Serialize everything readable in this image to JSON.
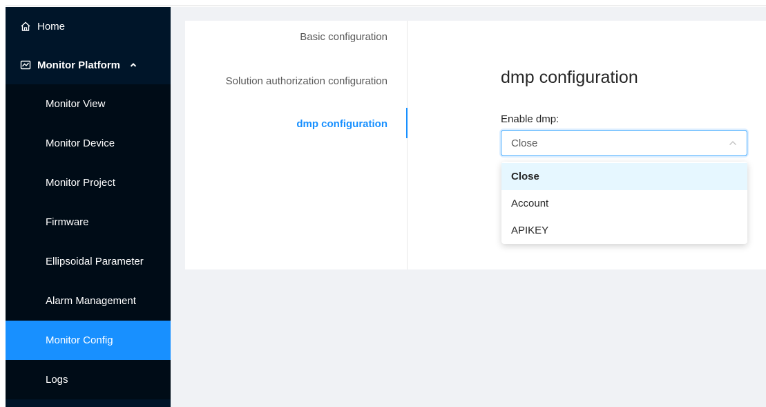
{
  "sidebar": {
    "home_label": "Home",
    "platform_label": "Monitor Platform",
    "items": [
      {
        "label": "Monitor View"
      },
      {
        "label": "Monitor Device"
      },
      {
        "label": "Monitor Project"
      },
      {
        "label": "Firmware"
      },
      {
        "label": "Ellipsoidal Parameter"
      },
      {
        "label": "Alarm Management"
      },
      {
        "label": "Monitor Config",
        "active": true
      },
      {
        "label": "Logs"
      }
    ]
  },
  "tabs": [
    {
      "label": "Basic configuration"
    },
    {
      "label": "Solution authorization configuration"
    },
    {
      "label": "dmp configuration",
      "active": true
    }
  ],
  "panel": {
    "title": "dmp configuration",
    "field_label": "Enable dmp:",
    "select_value": "Close",
    "options": [
      {
        "label": "Close",
        "selected": true
      },
      {
        "label": "Account"
      },
      {
        "label": "APIKEY"
      }
    ]
  },
  "colors": {
    "sidebar_bg": "#001529",
    "submenu_bg": "#000c17",
    "accent": "#1890ff",
    "main_bg": "#f0f2f5"
  },
  "icons": [
    "home-icon",
    "line-chart-icon",
    "chevron-up-icon",
    "select-arrow-icon"
  ]
}
